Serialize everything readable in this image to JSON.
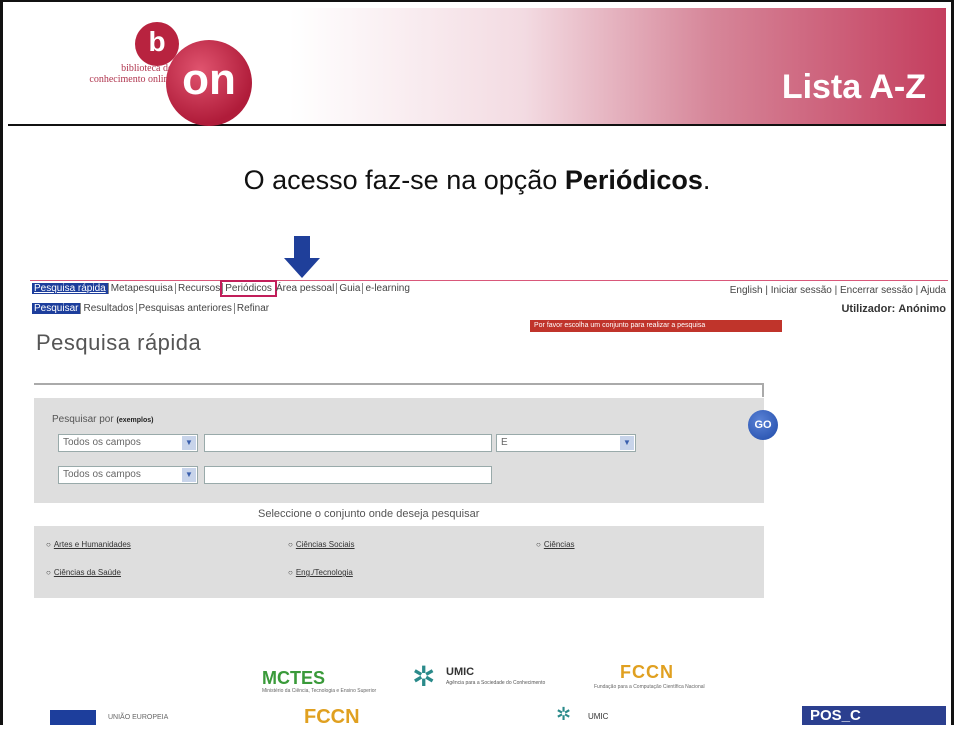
{
  "slide": {
    "title": "Lista A-Z",
    "caption_prefix": "O acesso faz-se na opção ",
    "caption_bold": "Periódicos",
    "caption_suffix": "."
  },
  "logo": {
    "text_line1": "biblioteca do",
    "text_line2": "conhecimento online",
    "b": "b",
    "on": "on"
  },
  "nav": {
    "primary": [
      "Pesquisa rápida",
      "Metapesquisa",
      "Recursos",
      "Periódicos",
      "Área pessoal",
      "Guia",
      "e-learning"
    ],
    "secondary": [
      "Pesquisar",
      "Resultados",
      "Pesquisas anteriores",
      "Refinar"
    ],
    "top_links": [
      "English",
      "Iniciar sessão",
      "Encerrar sessão",
      "Ajuda"
    ],
    "user_label": "Utilizador:",
    "user_name": "Anónimo"
  },
  "warning": "Por favor escolha um conjunto para realizar a pesquisa",
  "page_title": "Pesquisa rápida",
  "search": {
    "label": "Pesquisar por",
    "examples": "(exemplos)",
    "field1": "Todos os campos",
    "field2": "Todos os campos",
    "operator": "E",
    "go": "GO"
  },
  "sets": {
    "header": "Seleccione o conjunto onde deseja pesquisar",
    "options": [
      "Artes e Humanidades",
      "Ciências Sociais",
      "Ciências",
      "Ciências da Saúde",
      "Eng./Tecnologia"
    ]
  },
  "footer": {
    "mctes": "MCTES",
    "mctes_sub": "Ministério da Ciência, Tecnologia e Ensino Superior",
    "umic": "UMIC",
    "umic_sub": "Agência para a Sociedade do Conhecimento",
    "fccn": "FCCN",
    "fccn_sub": "Fundação para a Computação Científica Nacional",
    "eu": "UNIÃO EUROPEIA",
    "fccn2": "FCCN",
    "umic2": "UMIC",
    "pos": "POS_C"
  },
  "colors": {
    "accent": "#b8233f",
    "nav_active": "#1d3e9c",
    "highlight": "#c21e5a",
    "arrow": "#1f3f9a"
  }
}
